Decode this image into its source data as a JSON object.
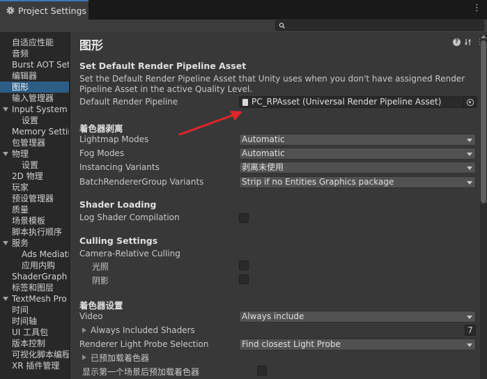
{
  "window": {
    "tab_title": "Project Settings",
    "tab_icon": "gear-icon",
    "menu_glyph": "⋮"
  },
  "search": {
    "placeholder": "",
    "value": ""
  },
  "sidebar": {
    "items": [
      {
        "label": "自适应性能",
        "indent": false,
        "expandable": false,
        "selected": false
      },
      {
        "label": "音频",
        "indent": false,
        "expandable": false,
        "selected": false
      },
      {
        "label": "Burst AOT Settings",
        "indent": false,
        "expandable": false,
        "selected": false
      },
      {
        "label": "编辑器",
        "indent": false,
        "expandable": false,
        "selected": false
      },
      {
        "label": "图形",
        "indent": false,
        "expandable": false,
        "selected": true
      },
      {
        "label": "输入管理器",
        "indent": false,
        "expandable": false,
        "selected": false
      },
      {
        "label": "Input System Package",
        "indent": false,
        "expandable": true,
        "selected": false
      },
      {
        "label": "设置",
        "indent": true,
        "expandable": false,
        "selected": false
      },
      {
        "label": "Memory Settings",
        "indent": false,
        "expandable": false,
        "selected": false
      },
      {
        "label": "包管理器",
        "indent": false,
        "expandable": false,
        "selected": false
      },
      {
        "label": "物理",
        "indent": false,
        "expandable": true,
        "selected": false
      },
      {
        "label": "设置",
        "indent": true,
        "expandable": false,
        "selected": false
      },
      {
        "label": "2D 物理",
        "indent": false,
        "expandable": false,
        "selected": false
      },
      {
        "label": "玩家",
        "indent": false,
        "expandable": false,
        "selected": false
      },
      {
        "label": "预设管理器",
        "indent": false,
        "expandable": false,
        "selected": false
      },
      {
        "label": "质量",
        "indent": false,
        "expandable": false,
        "selected": false
      },
      {
        "label": "场景模板",
        "indent": false,
        "expandable": false,
        "selected": false
      },
      {
        "label": "脚本执行顺序",
        "indent": false,
        "expandable": false,
        "selected": false
      },
      {
        "label": "服务",
        "indent": false,
        "expandable": true,
        "selected": false
      },
      {
        "label": "Ads Mediation",
        "indent": true,
        "expandable": false,
        "selected": false
      },
      {
        "label": "应用内购",
        "indent": true,
        "expandable": false,
        "selected": false
      },
      {
        "label": "ShaderGraph",
        "indent": false,
        "expandable": false,
        "selected": false
      },
      {
        "label": "标签和图层",
        "indent": false,
        "expandable": false,
        "selected": false
      },
      {
        "label": "TextMesh Pro",
        "indent": false,
        "expandable": true,
        "selected": false
      },
      {
        "label": "时间",
        "indent": false,
        "expandable": false,
        "selected": false
      },
      {
        "label": "时间轴",
        "indent": false,
        "expandable": false,
        "selected": false
      },
      {
        "label": "UI 工具包",
        "indent": false,
        "expandable": false,
        "selected": false
      },
      {
        "label": "版本控制",
        "indent": false,
        "expandable": false,
        "selected": false
      },
      {
        "label": "可视化脚本编程",
        "indent": false,
        "expandable": false,
        "selected": false
      },
      {
        "label": "XR 插件管理",
        "indent": false,
        "expandable": false,
        "selected": false
      }
    ]
  },
  "main": {
    "title": "图形",
    "srp_section": {
      "heading": "Set Default Render Pipeline Asset",
      "description": "Set the Default Render Pipeline Asset that Unity uses when you don't have assigned Render Pipeline Asset in the active Quality Level.",
      "field_label": "Default Render Pipeline",
      "field_value": "PC_RPAsset (Universal Render Pipeline Asset)"
    },
    "stripping": {
      "heading": "着色器剥离",
      "rows": [
        {
          "label": "Lightmap Modes",
          "value": "Automatic"
        },
        {
          "label": "Fog Modes",
          "value": "Automatic"
        },
        {
          "label": "Instancing Variants",
          "value": "剥离未使用"
        },
        {
          "label": "BatchRendererGroup Variants",
          "value": "Strip if no Entities Graphics package"
        }
      ]
    },
    "shader_loading": {
      "heading": "Shader Loading",
      "log_label": "Log Shader Compilation",
      "log_checked": false
    },
    "culling": {
      "heading": "Culling Settings",
      "camera_relative": "Camera-Relative Culling",
      "lights_label": "光照",
      "lights_checked": false,
      "shadows_label": "阴影",
      "shadows_checked": false
    },
    "shader_settings": {
      "heading": "着色器设置",
      "video_label": "Video",
      "video_value": "Always include",
      "always_included_label": "Always Included Shaders",
      "always_included_count": "7",
      "probe_label": "Renderer Light Probe Selection",
      "probe_value": "Find closest Light Probe",
      "preloaded_label": "已预加载着色器",
      "preload_after_label": "显示第一个场景后预加载着色器",
      "preload_after_checked": false
    }
  },
  "colors": {
    "selection": "#2c5d87",
    "tab_accent": "#3a79bb",
    "annotation_arrow": "#e0252a"
  }
}
